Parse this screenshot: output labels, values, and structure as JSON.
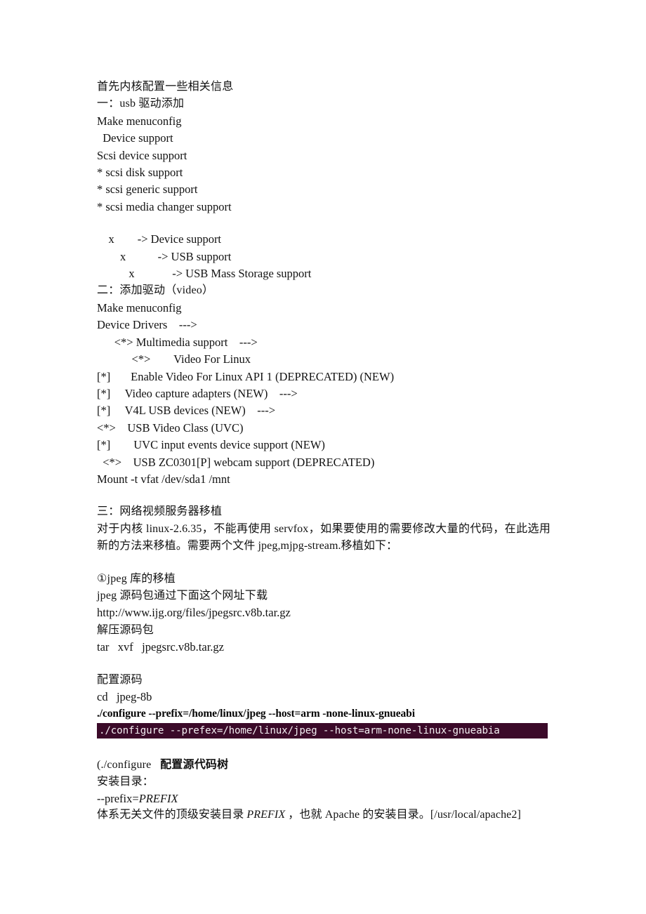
{
  "document": {
    "section_intro": "首先内核配置一些相关信息",
    "section_one": {
      "heading": "一：usb 驱动添加",
      "lines": [
        "Make menuconfig",
        "  Device support",
        "Scsi device support",
        "* scsi disk support",
        "* scsi generic support",
        "* scsi media changer support"
      ],
      "tree_lines": [
        "    x        -> Device support",
        "        x           -> USB support",
        "           x             -> USB Mass Storage support"
      ]
    },
    "section_two": {
      "heading": "二：添加驱动（video）",
      "lines": [
        "Make menuconfig",
        "Device Drivers    --->",
        "      <*> Multimedia support    --->",
        "            <*>        Video For Linux",
        "[*]       Enable Video For Linux API 1 (DEPRECATED) (NEW)",
        "[*]     Video capture adapters (NEW)    --->",
        "[*]     V4L USB devices (NEW)    --->",
        "<*>    USB Video Class (UVC)",
        "[*]        UVC input events device support (NEW)",
        "  <*>    USB ZC0301[P] webcam support (DEPRECATED)",
        "Mount -t vfat /dev/sda1 /mnt"
      ]
    },
    "section_three": {
      "heading": "三：网络视频服务器移植",
      "paragraph": "对于内核 linux-2.6.35，不能再使用 servfox，如果要使用的需要修改大量的代码，在此选用新的方法来移植。需要两个文件 jpeg,mjpg-stream.移植如下：",
      "jpeg_lib": {
        "title": "①jpeg 库的移植",
        "download_note": "jpeg 源码包通过下面这个网址下载",
        "url": "http://www.ijg.org/files/jpegsrc.v8b.tar.gz",
        "extract_note": "解压源码包",
        "extract_cmd": "tar   xvf   jpegsrc.v8b.tar.gz",
        "configure_note": "配置源码",
        "cd_cmd": "cd   jpeg-8b",
        "configure_cmd_bold": "./configure --prefix=/home/linux/jpeg --host=arm -none-linux-gnueabi",
        "terminal_highlight": "./configure --prefex=/home/linux/jpeg --host=arm-none-linux-gnueabia",
        "terminal_bg": "#3b0a29",
        "terminal_fg": "#f2eef1"
      },
      "configure_help": {
        "line_prefix": "(./configure",
        "line_bold": "配置源代码树",
        "install_dir_label": "安装目录：",
        "prefix_plain": "--prefix=",
        "prefix_italic": "PREFIX",
        "desc_part1": "    体系无关文件的顶级安装目录 ",
        "desc_italic": "PREFIX",
        "desc_part2": " ，也就 Apache 的安装目录。[/usr/local/apache2]"
      }
    }
  }
}
